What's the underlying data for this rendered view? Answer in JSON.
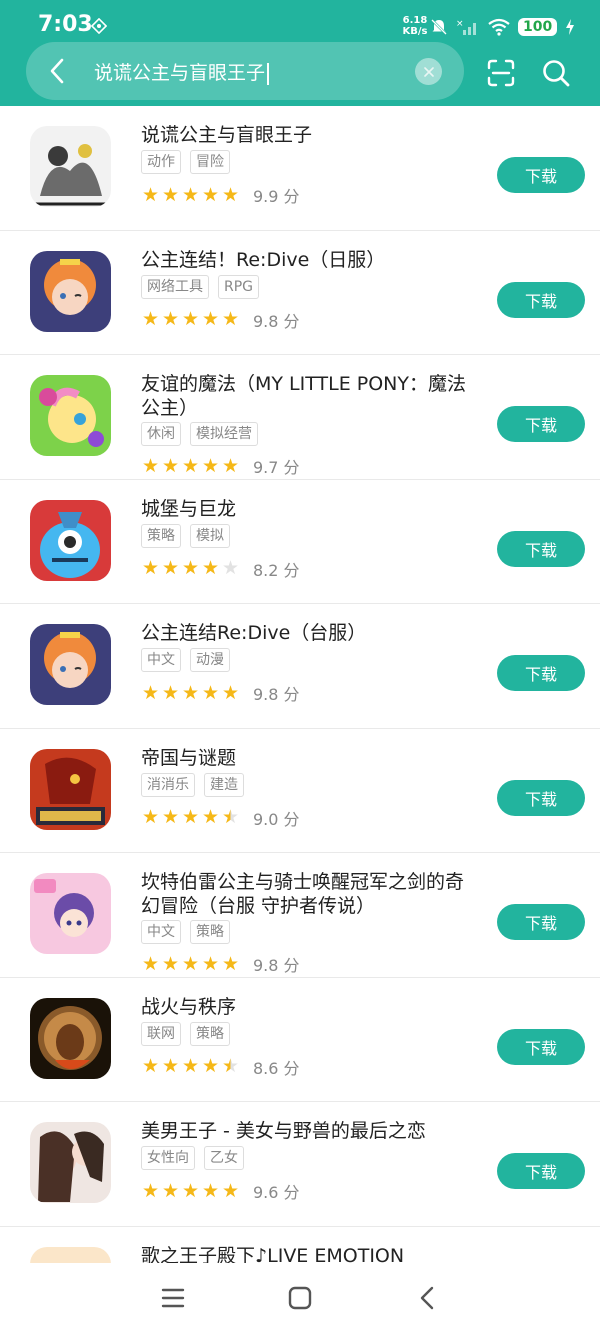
{
  "status_bar": {
    "time": "7:03",
    "net_speed_value": "6.18",
    "net_speed_unit": "KB/s",
    "battery": "100"
  },
  "search": {
    "query": "说谎公主与盲眼王子"
  },
  "download_label": "下载",
  "score_unit": "分",
  "apps": [
    {
      "name": "说谎公主与盲眼王子",
      "tags": [
        "动作",
        "冒险"
      ],
      "stars": 5,
      "score": "9.9"
    },
    {
      "name": "公主连结！Re:Dive（日服）",
      "tags": [
        "网络工具",
        "RPG"
      ],
      "stars": 5,
      "score": "9.8"
    },
    {
      "name": "友谊的魔法（MY LITTLE PONY：魔法公主）",
      "tags": [
        "休闲",
        "模拟经营"
      ],
      "stars": 5,
      "score": "9.7"
    },
    {
      "name": "城堡与巨龙",
      "tags": [
        "策略",
        "模拟"
      ],
      "stars": 4,
      "score": "8.2"
    },
    {
      "name": "公主连结Re:Dive（台服）",
      "tags": [
        "中文",
        "动漫"
      ],
      "stars": 5,
      "score": "9.8"
    },
    {
      "name": "帝国与谜题",
      "tags": [
        "消消乐",
        "建造"
      ],
      "stars": 4.5,
      "score": "9.0"
    },
    {
      "name": "坎特伯雷公主与骑士唤醒冠军之剑的奇幻冒险（台服 守护者传说）",
      "tags": [
        "中文",
        "策略"
      ],
      "stars": 5,
      "score": "9.8"
    },
    {
      "name": "战火与秩序",
      "tags": [
        "联网",
        "策略"
      ],
      "stars": 4.5,
      "score": "8.6"
    },
    {
      "name": "美男王子 - 美女与野兽的最后之恋",
      "tags": [
        "女性向",
        "乙女"
      ],
      "stars": 5,
      "score": "9.6"
    },
    {
      "name": "歌之王子殿下♪LIVE EMOTION",
      "tags": [],
      "stars": 0,
      "score": ""
    }
  ],
  "colors": {
    "accent": "#22b49e",
    "star": "#f5b818",
    "star_empty": "#e2e2e2"
  },
  "icons": {
    "back": "chevron-left-icon",
    "clear": "close-icon",
    "scan": "scan-icon",
    "search": "search-icon",
    "nav": [
      "menu-icon",
      "home-icon",
      "back-icon"
    ]
  }
}
